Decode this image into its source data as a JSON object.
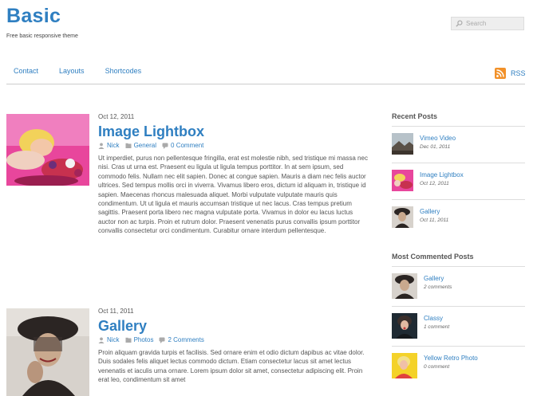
{
  "site": {
    "title": "Basic",
    "tagline": "Free basic responsive theme"
  },
  "search": {
    "placeholder": "Search"
  },
  "nav": {
    "items": [
      "Contact",
      "Layouts",
      "Shortcodes"
    ],
    "rss_label": "RSS"
  },
  "posts": [
    {
      "date": "Oct 12, 2011",
      "title": "Image Lightbox",
      "author": "Nick",
      "category": "General",
      "comments": "0 Comment",
      "excerpt": "Ut imperdiet, purus non pellentesque fringilla, erat est molestie nibh, sed tristique mi massa nec nisi. Cras ut urna est. Praesent eu ligula ut ligula tempus porttitor. In at sem ipsum, sed commodo felis. Nullam nec elit sapien. Donec at congue sapien. Mauris a diam nec felis auctor ultrices. Sed tempus mollis orci in viverra. Vivamus libero eros, dictum id aliquam in, tristique id sapien. Maecenas rhoncus malesuada aliquet. Morbi vulputate vulputate mauris quis condimentum. Ut ut ligula et mauris accumsan tristique ut nec lacus. Cras tempus pretium sagittis. Praesent porta libero nec magna vulputate porta. Vivamus in dolor eu lacus luctus auctor non ac turpis. Proin et rutrum dolor. Praesent venenatis purus convallis ipsum porttitor convallis consectetur orci condimentum. Curabitur ornare interdum pellentesque."
    },
    {
      "date": "Oct 11, 2011",
      "title": "Gallery",
      "author": "Nick",
      "category": "Photos",
      "comments": "2 Comments",
      "excerpt": "Proin aliquam gravida turpis et facilisis. Sed ornare enim et odio dictum dapibus ac vitae dolor. Duis sodales felis aliquet lectus commodo dictum. Etiam consectetur lacus sit amet lectus venenatis et iaculis urna ornare. Lorem ipsum dolor sit amet, consectetur adipiscing elit. Proin erat leo, condimentum sit amet"
    }
  ],
  "sidebar": {
    "recent": {
      "heading": "Recent Posts",
      "items": [
        {
          "title": "Vimeo Video",
          "sub": "Dec 01, 2011"
        },
        {
          "title": "Image Lightbox",
          "sub": "Oct 12, 2011"
        },
        {
          "title": "Gallery",
          "sub": "Oct 11, 2011"
        }
      ]
    },
    "commented": {
      "heading": "Most Commented Posts",
      "items": [
        {
          "title": "Gallery",
          "sub": "2 comments"
        },
        {
          "title": "Classy",
          "sub": "1 comment"
        },
        {
          "title": "Yellow Retro Photo",
          "sub": "0 comment"
        }
      ]
    }
  },
  "colors": {
    "link": "#2f7fc1",
    "rss": "#f29129"
  }
}
